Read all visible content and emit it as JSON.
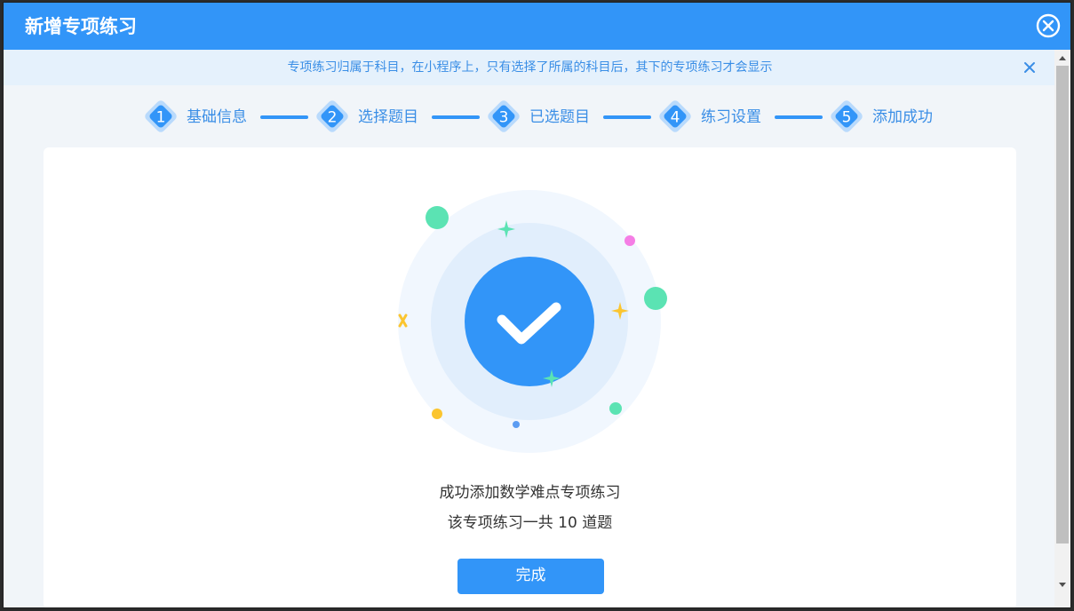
{
  "dialog": {
    "title": "新增专项练习"
  },
  "notice": {
    "text": "专项练习归属于科目，在小程序上，只有选择了所属的科目后，其下的专项练习才会显示"
  },
  "steps": [
    {
      "number": "1",
      "label": "基础信息"
    },
    {
      "number": "2",
      "label": "选择题目"
    },
    {
      "number": "3",
      "label": "已选题目"
    },
    {
      "number": "4",
      "label": "练习设置"
    },
    {
      "number": "5",
      "label": "添加成功"
    }
  ],
  "result": {
    "message": "成功添加数学难点专项练习",
    "count_message": "该专项练习一共 10 道题",
    "done_label": "完成"
  },
  "colors": {
    "primary": "#3295f8",
    "accent_green": "#5be3b3",
    "accent_yellow": "#fbc52f",
    "accent_pink": "#f57ee5"
  },
  "icons": {
    "close": "close-circle-icon",
    "notice_close": "close-icon",
    "success": "check-icon"
  }
}
